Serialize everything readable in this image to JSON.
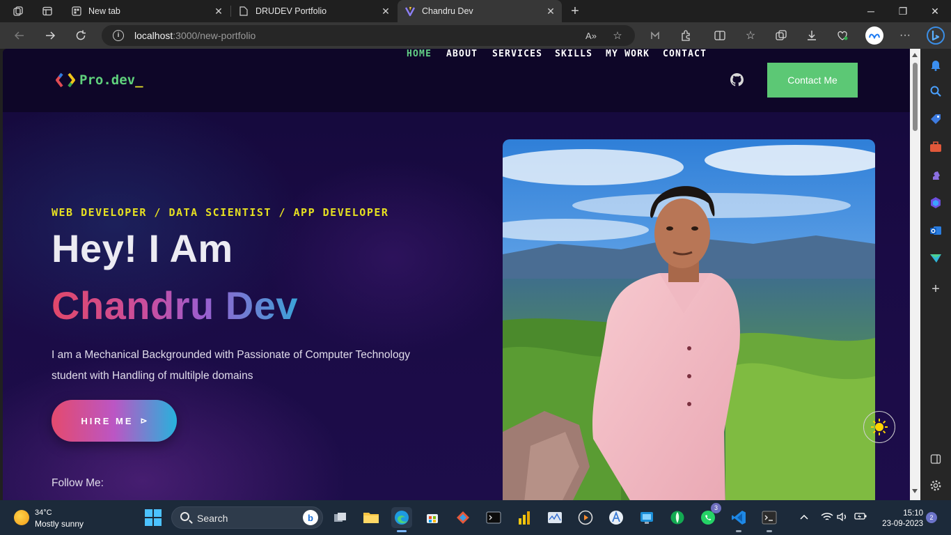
{
  "browser": {
    "tabs": [
      {
        "title": "New tab",
        "active": false
      },
      {
        "title": "DRUDEV Portfolio",
        "active": false
      },
      {
        "title": "Chandru Dev",
        "active": true
      }
    ],
    "url_host": "localhost",
    "url_rest": ":3000/new-portfolio",
    "new_tab_label": "+"
  },
  "site": {
    "logo": {
      "text": "Pro.dev",
      "cursor": "_"
    },
    "nav": [
      "HOME",
      "ABOUT",
      "SERVICES",
      "SKILLS",
      "MY WORK",
      "CONTACT"
    ],
    "nav_active": "HOME",
    "contact_button": "Contact Me",
    "tagline": "WEB DEVELOPER / DATA SCIENTIST / APP DEVELOPER",
    "greeting": "Hey! I Am",
    "name": "Chandru Dev",
    "intro": "I am a Mechanical Backgrounded with Passionate of Computer Technology student with Handling of multilple domains",
    "hire_button": "HIRE ME",
    "hire_arrow": "⊳",
    "follow_label": "Follow Me:"
  },
  "taskbar": {
    "weather": {
      "temp": "34°C",
      "condition": "Mostly sunny"
    },
    "search_label": "Search",
    "whatsapp_badge": "3",
    "time": "15:10",
    "date": "23-09-2023",
    "notification_count": "2"
  },
  "colors": {
    "accent_green": "#5cc875",
    "tagline_yellow": "#e6e021",
    "page_bg": "#14093a"
  }
}
